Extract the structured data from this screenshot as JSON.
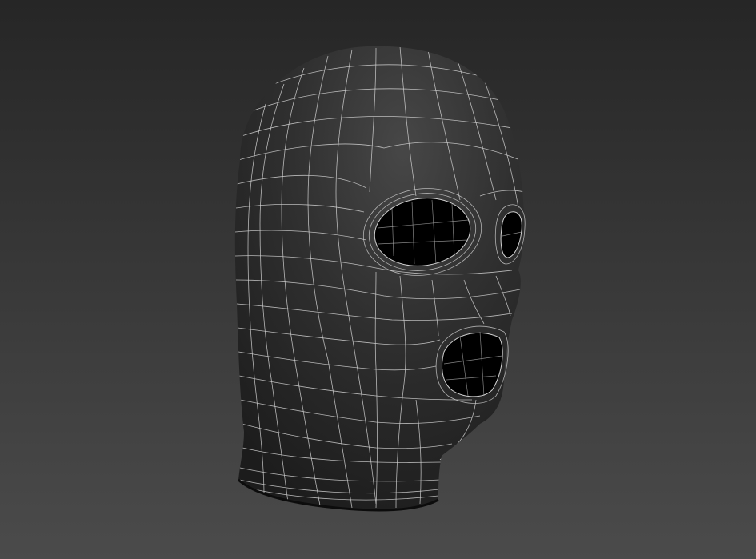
{
  "viewport": {
    "subject": "balaclava-mask-3d-model",
    "render_mode": "shaded-with-wireframe",
    "background_top_color": "#262626",
    "background_bottom_color": "#4b4b4b",
    "mesh_base_color": "#262626",
    "mesh_highlight_color": "#444444",
    "wire_color": "#d2d2d2",
    "opening_color": "#000000"
  }
}
